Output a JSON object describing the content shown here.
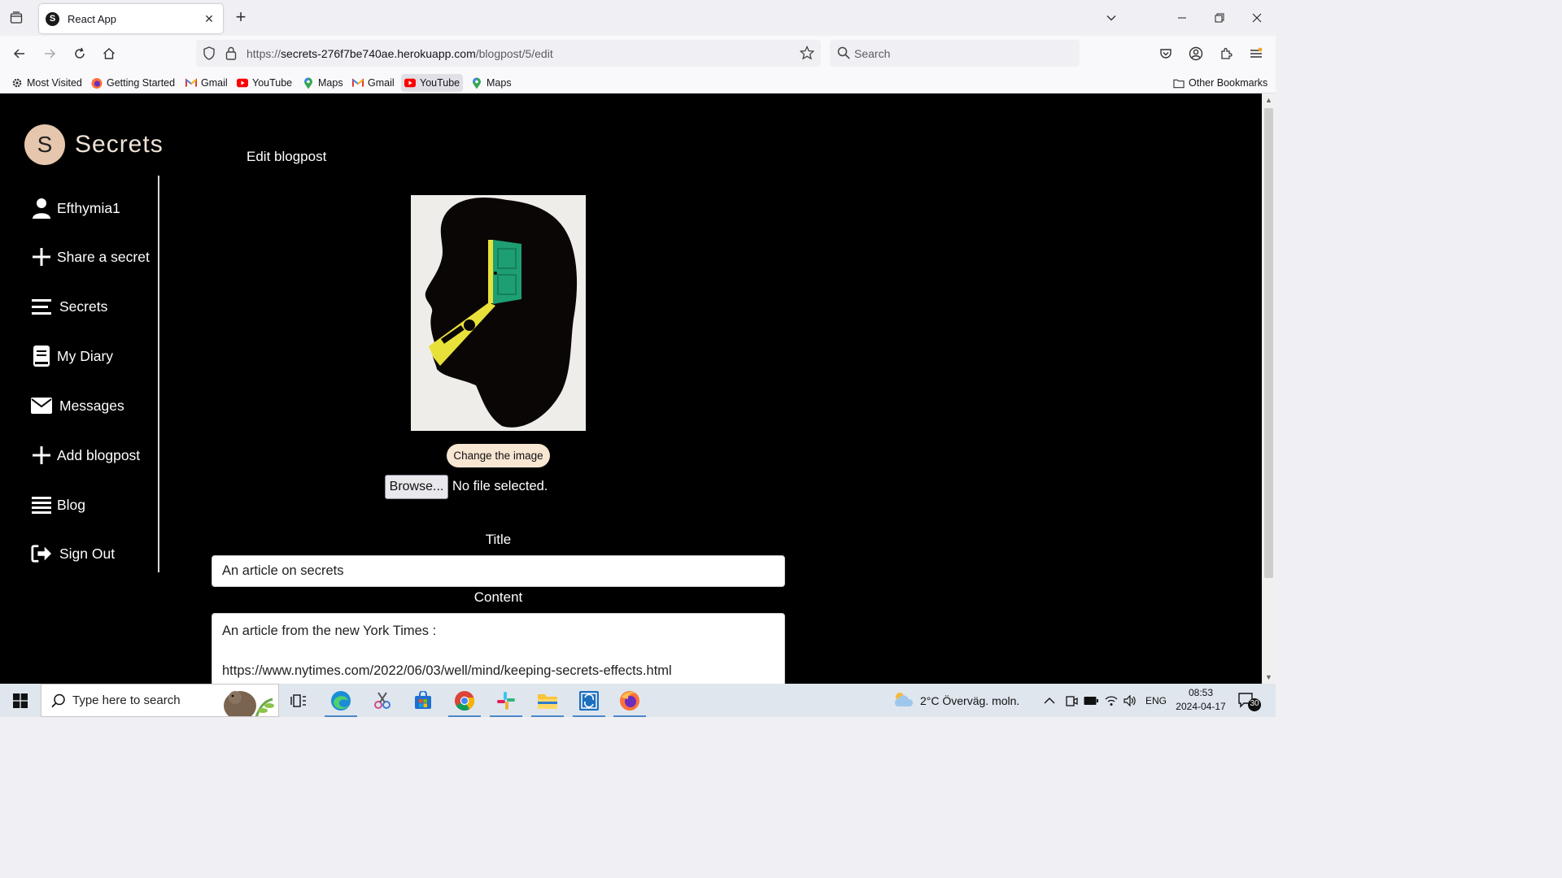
{
  "browser": {
    "tab_title": "React App",
    "tab_favicon_letter": "S",
    "url_scheme": "https://",
    "url_host": "secrets-276f7be740ae.herokuapp.com",
    "url_path": "/blogpost/5/edit",
    "search_placeholder": "Search",
    "bookmarks": [
      {
        "label": "Most Visited",
        "icon": "gear-icon"
      },
      {
        "label": "Getting Started",
        "icon": "firefox-icon"
      },
      {
        "label": "Gmail",
        "icon": "gmail-icon"
      },
      {
        "label": "YouTube",
        "icon": "youtube-icon"
      },
      {
        "label": "Maps",
        "icon": "maps-icon"
      },
      {
        "label": "Gmail",
        "icon": "gmail-icon"
      },
      {
        "label": "YouTube",
        "icon": "youtube-icon"
      },
      {
        "label": "Maps",
        "icon": "maps-icon"
      }
    ],
    "other_bookmarks": "Other Bookmarks"
  },
  "app": {
    "logo_letter": "S",
    "logo_text": "Secrets",
    "sidebar": [
      {
        "label": "Efthymia1",
        "icon": "user-icon"
      },
      {
        "label": "Share a secret",
        "icon": "plus-icon"
      },
      {
        "label": "Secrets",
        "icon": "list-icon"
      },
      {
        "label": "My Diary",
        "icon": "book-icon"
      },
      {
        "label": "Messages",
        "icon": "envelope-icon"
      },
      {
        "label": "Add blogpost",
        "icon": "plus-icon"
      },
      {
        "label": "Blog",
        "icon": "list-icon"
      },
      {
        "label": "Sign Out",
        "icon": "sign-out-icon"
      }
    ],
    "page_title": "Edit blogpost",
    "change_image_label": "Change the image",
    "browse_label": "Browse...",
    "file_status": "No file selected.",
    "title_label": "Title",
    "title_value": "An article on secrets",
    "content_label": "Content",
    "content_lines": [
      "An article from the new York Times :",
      "",
      "https://www.nytimes.com/2022/06/03/well/mind/keeping-secrets-effects.html"
    ]
  },
  "taskbar": {
    "search_placeholder": "Type here to search",
    "weather": "2°C  Överväg. moln.",
    "language": "ENG",
    "time": "08:53",
    "date": "2024-04-17",
    "notifications": "30"
  },
  "colors": {
    "page_bg": "#000000",
    "logo_circle": "#e6c7ad",
    "button_bg": "#f7e6d2"
  }
}
